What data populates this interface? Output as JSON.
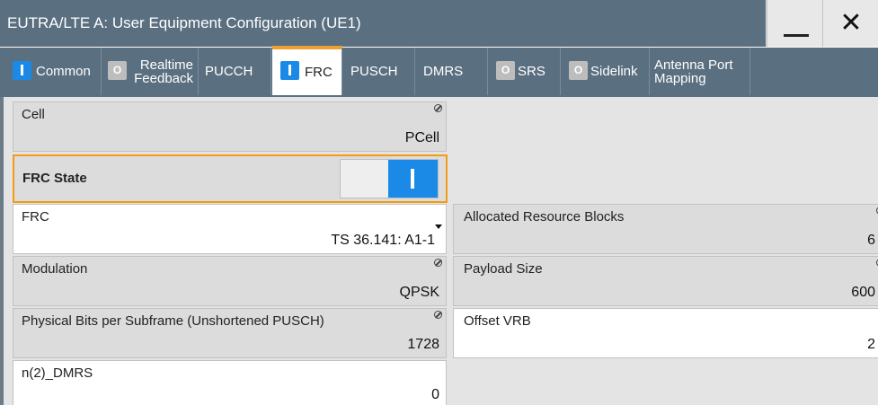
{
  "window": {
    "title": "EUTRA/LTE A: User Equipment Configuration (UE1)",
    "minimize_icon": "minimize-icon",
    "close_icon": "close-icon",
    "close_glyph": "✕"
  },
  "tabs": [
    {
      "label": "Common",
      "indicator": "on"
    },
    {
      "label": "Realtime Feedback",
      "line1": "Realtime",
      "line2": "Feedback",
      "indicator": "off"
    },
    {
      "label": "PUCCH",
      "indicator": "none"
    },
    {
      "label": "FRC",
      "indicator": "on",
      "active": true
    },
    {
      "label": "PUSCH",
      "indicator": "none"
    },
    {
      "label": "DMRS",
      "indicator": "none"
    },
    {
      "label": "SRS",
      "indicator": "off"
    },
    {
      "label": "Sidelink",
      "indicator": "off"
    },
    {
      "label": "Antenna Port Mapping",
      "line1": "Antenna Port",
      "line2": "Mapping",
      "indicator": "none"
    }
  ],
  "indicator_glyphs": {
    "on": "I",
    "off": "O"
  },
  "fields": {
    "cell": {
      "label": "Cell",
      "value": "PCell"
    },
    "frc_state": {
      "label": "FRC State",
      "value": "on"
    },
    "frc": {
      "label": "FRC",
      "value": "TS 36.141:  A1-1"
    },
    "allocated_rb": {
      "label": "Allocated Resource Blocks",
      "value": "6"
    },
    "modulation": {
      "label": "Modulation",
      "value": "QPSK"
    },
    "payload_size": {
      "label": "Payload Size",
      "value": "600"
    },
    "physical_bits": {
      "label": "Physical Bits per Subframe (Unshortened PUSCH)",
      "value": "1728"
    },
    "offset_vrb": {
      "label": "Offset VRB",
      "value": "2"
    },
    "n2_dmrs": {
      "label": "n(2)_DMRS",
      "value": "0"
    }
  },
  "colors": {
    "title_bg": "#5a6f80",
    "accent_orange": "#f39c12",
    "toggle_blue": "#1a8ae6"
  }
}
